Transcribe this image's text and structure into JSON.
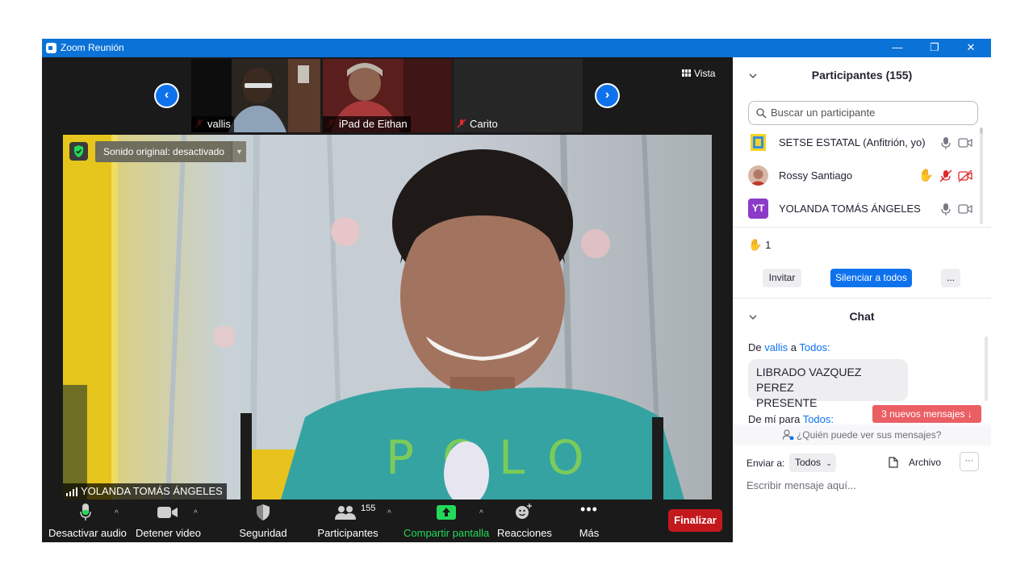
{
  "window": {
    "title": "Zoom Reunión",
    "controls": [
      "—",
      "❐",
      "✕"
    ]
  },
  "stage": {
    "vista_label": "Vista",
    "thumbnails": [
      {
        "name": "vallis"
      },
      {
        "name": "iPad de Eithan"
      },
      {
        "name": "Carito"
      }
    ],
    "main_video": {
      "sound_label": "Sonido original: desactivado",
      "speaker_name": "YOLANDA TOMÁS ÁNGELES"
    }
  },
  "toolbar": {
    "mute": "Desactivar audio",
    "stop_video": "Detener video",
    "security": "Seguridad",
    "participants": "Participantes",
    "participants_count": "155",
    "share": "Compartir pantalla",
    "reactions": "Reacciones",
    "more": "Más",
    "end": "Finalizar"
  },
  "panel": {
    "participants_title": "Participantes (155)",
    "search_placeholder": "Buscar un participante",
    "participants": [
      {
        "name": "SETSE ESTATAL (Anfitrión, yo)"
      },
      {
        "name": "Rossy Santiago"
      },
      {
        "name": "YOLANDA TOMÁS ÁNGELES",
        "initials": "YT"
      }
    ],
    "hands_raised": "1",
    "invite": "Invitar",
    "mute_all": "Silenciar a todos",
    "more": "...",
    "chat_title": "Chat",
    "chat": {
      "msg1_prefix": "De",
      "msg1_from": "vallis",
      "msg1_mid": "a",
      "msg1_to": "Todos:",
      "msg1_line1": "LIBRADO VAZQUEZ PEREZ",
      "msg1_line2": "PRESENTE",
      "msg2_prefix": "De mí para",
      "msg2_to": "Todos:",
      "new_messages": "3 nuevos mensajes",
      "who_can_see": "¿Quién puede ver sus mensajes?",
      "send_to_label": "Enviar a:",
      "send_to_value": "Todos",
      "file_label": "Archivo",
      "more": "···",
      "input_placeholder": "Escribir mensaje aquí..."
    }
  },
  "colors": {
    "accent": "#0e72ed",
    "titlebar": "#0b72d8",
    "end": "#c4191c",
    "share": "#23d959",
    "new_msgs": "#ea5f64"
  }
}
